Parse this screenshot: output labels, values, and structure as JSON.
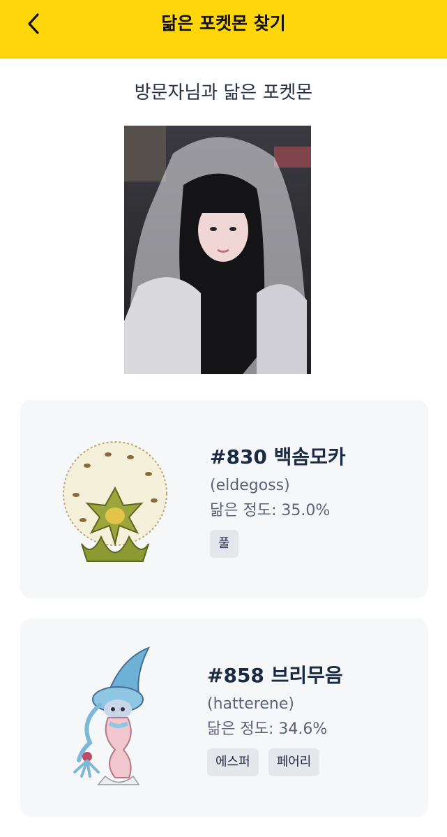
{
  "header": {
    "title": "닮은 포켓몬 찾기",
    "back_icon": "chevron-left-icon"
  },
  "section": {
    "title": "방문자님과 닮은 포켓몬"
  },
  "results": [
    {
      "title": "#830 백솜모카",
      "english": "(eldegoss)",
      "similarity": "닮은 정도: 35.0%",
      "types": [
        "풀"
      ]
    },
    {
      "title": "#858 브리무음",
      "english": "(hatterene)",
      "similarity": "닮은 정도: 34.6%",
      "types": [
        "에스퍼",
        "페어리"
      ]
    }
  ],
  "colors": {
    "header_bg": "#ffd60a",
    "card_bg": "#f6f7f9",
    "badge_bg": "#e4e7ec"
  }
}
